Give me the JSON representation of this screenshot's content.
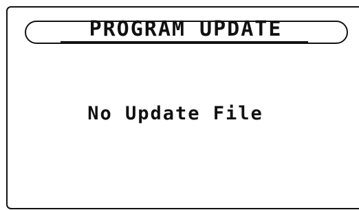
{
  "screen": {
    "title": "PROGRAM UPDATE",
    "message": "No Update File"
  }
}
